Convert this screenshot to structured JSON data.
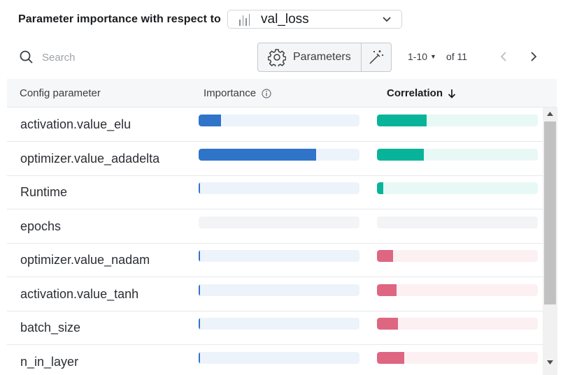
{
  "header": {
    "title": "Parameter importance with respect to",
    "metric": "val_loss",
    "metric_icon": "bar-chart-icon"
  },
  "toolbar": {
    "search_placeholder": "Search",
    "search_value": "",
    "parameters_label": "Parameters",
    "page_range": "1-10",
    "page_total": "of 11"
  },
  "table": {
    "columns": [
      "Config parameter",
      "Importance",
      "Correlation"
    ],
    "sorted_by": "Correlation",
    "sort_direction": "descending",
    "rows": [
      {
        "param": "activation.value_elu",
        "importance": 0.14,
        "correlation": 0.31,
        "correlation_sign": "positive"
      },
      {
        "param": "optimizer.value_adadelta",
        "importance": 0.73,
        "correlation": 0.29,
        "correlation_sign": "positive"
      },
      {
        "param": "Runtime",
        "importance": 0.01,
        "correlation": 0.04,
        "correlation_sign": "positive"
      },
      {
        "param": "epochs",
        "importance": 0.0,
        "correlation": 0.0,
        "correlation_sign": "none"
      },
      {
        "param": "optimizer.value_nadam",
        "importance": 0.005,
        "correlation": 0.1,
        "correlation_sign": "negative"
      },
      {
        "param": "activation.value_tanh",
        "importance": 0.005,
        "correlation": 0.12,
        "correlation_sign": "negative"
      },
      {
        "param": "batch_size",
        "importance": 0.008,
        "correlation": 0.13,
        "correlation_sign": "negative"
      },
      {
        "param": "n_in_layer",
        "importance": 0.008,
        "correlation": 0.17,
        "correlation_sign": "negative"
      }
    ]
  },
  "colors": {
    "importance_fill": "#2f74c9",
    "importance_track": "#edf3fa",
    "positive_fill": "#07b49a",
    "positive_track": "#e8f8f5",
    "negative_fill": "#de6681",
    "negative_track": "#fcf0f2",
    "empty_track": "#f3f4f6"
  }
}
